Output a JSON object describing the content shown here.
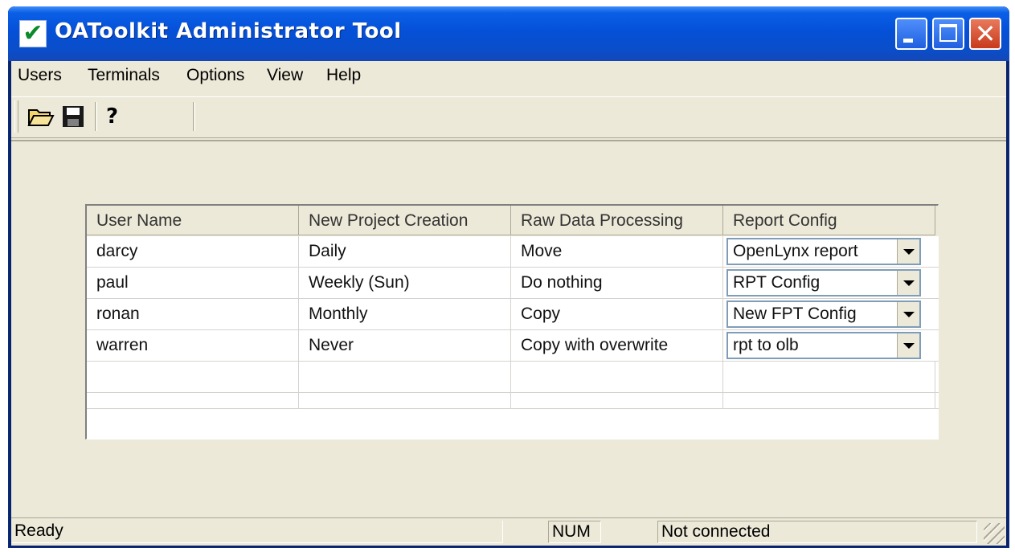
{
  "window": {
    "title": "OAToolkit Administrator Tool",
    "icon": "checkmark-icon",
    "title_buttons": [
      "minimize",
      "maximize",
      "close"
    ]
  },
  "menu": {
    "items": [
      "Users",
      "Terminals",
      "Options",
      "View",
      "Help"
    ]
  },
  "toolbar": {
    "icons": [
      "open-folder-icon",
      "save-icon",
      "help-icon"
    ]
  },
  "table": {
    "columns": [
      "User Name",
      "New Project Creation",
      "Raw Data Processing",
      "Report Config"
    ],
    "rows": [
      {
        "user": "darcy",
        "creation": "Daily",
        "processing": "Move",
        "report": "OpenLynx report"
      },
      {
        "user": "paul",
        "creation": "Weekly (Sun)",
        "processing": "Do nothing",
        "report": "RPT Config"
      },
      {
        "user": "ronan",
        "creation": "Monthly",
        "processing": "Copy",
        "report": "New FPT Config"
      },
      {
        "user": "warren",
        "creation": "Never",
        "processing": "Copy with overwrite",
        "report": "rpt to olb"
      }
    ]
  },
  "status": {
    "message": "Ready",
    "num": "NUM",
    "connection": "Not connected"
  },
  "colors": {
    "titlebar": "#0550d8",
    "client_bg": "#ece9d8",
    "close_button": "#c8391b"
  }
}
